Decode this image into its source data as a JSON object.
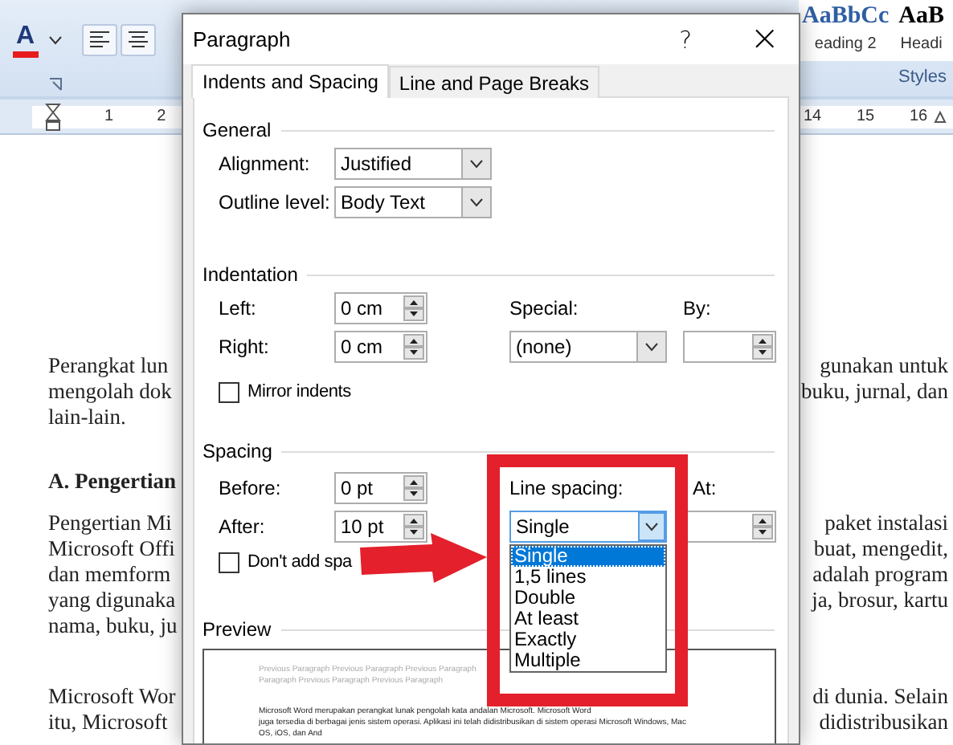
{
  "ribbon": {
    "font_color": {
      "label": "A",
      "color": "#e81c1c"
    },
    "style_samples": [
      {
        "sample": "AaBbCc",
        "name": "eading 2",
        "color": "#2e5fa3"
      },
      {
        "sample": "AaB",
        "name": "Headi",
        "color": "#000000"
      }
    ],
    "group_label": "Styles"
  },
  "ruler": {
    "left_numbers": [
      "1",
      "2"
    ],
    "right_numbers": [
      "14",
      "15",
      "16"
    ]
  },
  "document": {
    "blocks": [
      {
        "kind": "paragraph",
        "lines": [
          {
            "left": "Perangkat lun",
            "right": "gunakan untuk"
          },
          {
            "left": "mengolah dok",
            "right": "buku, jurnal, dan"
          },
          {
            "left": "lain-lain."
          }
        ]
      },
      {
        "kind": "heading",
        "lines": [
          {
            "left": "A. Pengertian"
          }
        ]
      },
      {
        "kind": "paragraph",
        "lines": [
          {
            "left": "Pengertian Mi",
            "right": "paket instalasi"
          },
          {
            "left": "Microsoft Offi",
            "right": "buat, mengedit,"
          },
          {
            "left": "dan memform",
            "right": "adalah program"
          },
          {
            "left": "yang digunaka",
            "right": "ja, brosur, kartu"
          },
          {
            "left": "nama, buku, ju"
          }
        ]
      },
      {
        "kind": "paragraph",
        "lines": [
          {
            "left": "Microsoft Wor",
            "right": "di dunia. Selain"
          },
          {
            "left": "itu, Microsoft",
            "right": "didistribusikan"
          }
        ]
      }
    ]
  },
  "dialog": {
    "title": "Paragraph",
    "help": "?",
    "close": "×",
    "tabs": [
      {
        "label": "Indents and Spacing",
        "selected": true
      },
      {
        "label": "Line and Page Breaks",
        "selected": false
      }
    ],
    "general": {
      "heading": "General",
      "alignment": {
        "label": "Alignment:",
        "value": "Justified"
      },
      "outline_level": {
        "label": "Outline level:",
        "value": "Body Text"
      }
    },
    "indentation": {
      "heading": "Indentation",
      "left": {
        "label": "Left:",
        "value": "0 cm"
      },
      "right": {
        "label": "Right:",
        "value": "0 cm"
      },
      "special": {
        "label": "Special:",
        "value": "(none)"
      },
      "by": {
        "label": "By:"
      },
      "mirror_indents": {
        "label": "Mirror indents",
        "checked": false
      }
    },
    "spacing": {
      "heading": "Spacing",
      "before": {
        "label": "Before:",
        "value": "0 pt"
      },
      "after": {
        "label": "After:",
        "value": "10 pt"
      },
      "line_spacing": {
        "label": "Line spacing:",
        "value": "Single",
        "open": true,
        "options": [
          {
            "label": "Single",
            "selected": true
          },
          {
            "label": "1,5 lines",
            "selected": false
          },
          {
            "label": "Double",
            "selected": false
          },
          {
            "label": "At least",
            "selected": false
          },
          {
            "label": "Exactly",
            "selected": false
          },
          {
            "label": "Multiple",
            "selected": false
          }
        ]
      },
      "at": {
        "label": "At:"
      },
      "dont_add_space": {
        "label": "Don't add spa",
        "checked": false
      }
    },
    "preview": {
      "heading": "Preview",
      "previous_lines": [
        "Previous Paragraph Previous Paragraph Previous Paragraph",
        "Paragraph Previous Paragraph Previous Paragraph"
      ],
      "sample_lines": [
        "Microsoft Word merupakan perangkat lunak pengolah kata andalan Microsoft. Microsoft Word",
        "juga tersedia di berbagai jenis sistem operasi. Aplikasi ini telah didistribusikan di sistem operasi Microsoft Windows, Mac",
        "OS, iOS, dan And"
      ]
    }
  }
}
